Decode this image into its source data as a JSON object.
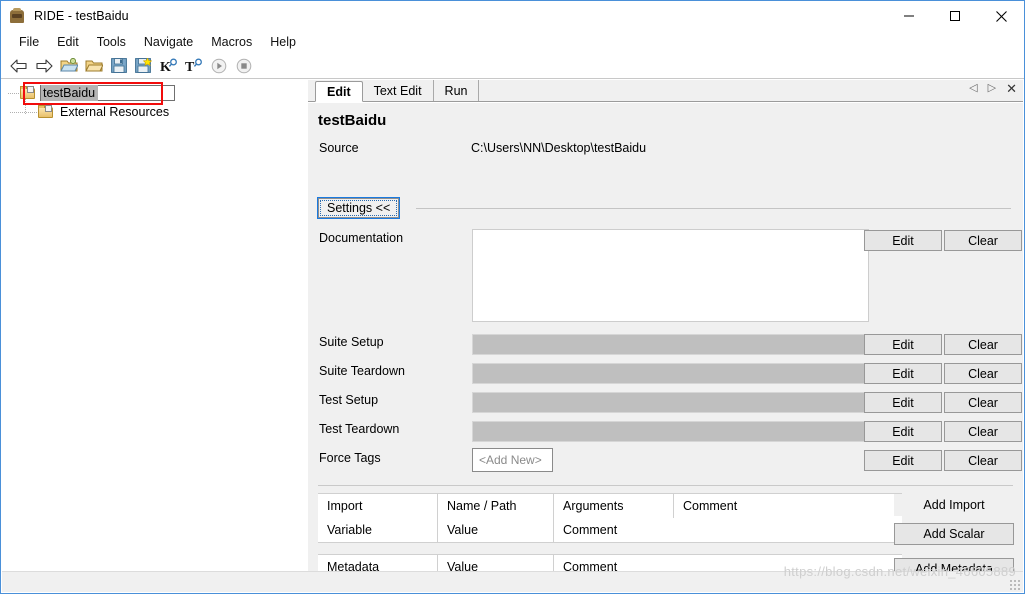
{
  "window": {
    "title": "RIDE - testBaidu",
    "app_icon": "robot-icon",
    "minimize": "—",
    "maximize": "□",
    "close": "✕"
  },
  "menubar": {
    "items": [
      {
        "label": "File"
      },
      {
        "label": "Edit"
      },
      {
        "label": "Tools"
      },
      {
        "label": "Navigate"
      },
      {
        "label": "Macros"
      },
      {
        "label": "Help"
      }
    ]
  },
  "toolbar": {
    "buttons": [
      {
        "name": "back-arrow-icon",
        "glyph": "⇦"
      },
      {
        "name": "forward-arrow-icon",
        "glyph": "⇨"
      },
      {
        "name": "open-project-icon",
        "glyph": "folder-gear"
      },
      {
        "name": "open-folder-icon",
        "glyph": "folder"
      },
      {
        "name": "save-icon",
        "glyph": "floppy"
      },
      {
        "name": "save-all-icon",
        "glyph": "floppy-star"
      },
      {
        "name": "search-keyword-icon",
        "glyph": "K"
      },
      {
        "name": "search-tests-icon",
        "glyph": "T"
      },
      {
        "name": "run-icon",
        "glyph": "▶"
      },
      {
        "name": "stop-icon",
        "glyph": "■"
      }
    ]
  },
  "tree": {
    "root": {
      "label": "testBaidu",
      "icon": "suite-folder-icon",
      "selected": true,
      "expanded": true,
      "editing": true
    },
    "children": [
      {
        "label": "External Resources",
        "icon": "resource-folder-icon"
      }
    ],
    "annotation_color": "#f10c0c"
  },
  "editor": {
    "tabs": [
      {
        "label": "Edit",
        "active": true
      },
      {
        "label": "Text Edit",
        "active": false
      },
      {
        "label": "Run",
        "active": false
      }
    ],
    "tab_tools": {
      "prev": "◁",
      "next": "▷",
      "close": "✕"
    },
    "suite_title": "testBaidu",
    "source_label": "Source",
    "source_value": "C:\\Users\\NN\\Desktop\\testBaidu",
    "settings_button": "Settings <<",
    "settings_rows": [
      {
        "label": "Documentation",
        "kind": "textarea",
        "value": "",
        "edit": "Edit",
        "clear": "Clear"
      },
      {
        "label": "Suite Setup",
        "kind": "disabled-field",
        "value": "",
        "edit": "Edit",
        "clear": "Clear"
      },
      {
        "label": "Suite Teardown",
        "kind": "disabled-field",
        "value": "",
        "edit": "Edit",
        "clear": "Clear"
      },
      {
        "label": "Test Setup",
        "kind": "disabled-field",
        "value": "",
        "edit": "Edit",
        "clear": "Clear"
      },
      {
        "label": "Test Teardown",
        "kind": "disabled-field",
        "value": "",
        "edit": "Edit",
        "clear": "Clear"
      },
      {
        "label": "Force Tags",
        "kind": "add-new",
        "value": "<Add New>",
        "edit": "Edit",
        "clear": "Clear"
      }
    ],
    "import_grid": {
      "rows": [
        {
          "cells": [
            "Import",
            "Name / Path",
            "Arguments",
            "Comment"
          ]
        },
        {
          "cells": [
            "Variable",
            "Value",
            "Comment",
            ""
          ]
        }
      ]
    },
    "metadata_grid": {
      "rows": [
        {
          "cells": [
            "Metadata",
            "Value",
            "Comment",
            ""
          ]
        }
      ]
    },
    "side_buttons": [
      {
        "label": "Add Import",
        "style": "flat"
      },
      {
        "label": "Add Scalar",
        "style": "raised"
      },
      {
        "label": "Add Metadata",
        "style": "raised"
      }
    ]
  },
  "statusbar": {
    "watermark": "https://blog.csdn.net/weixin_46605889"
  },
  "colors": {
    "accent": "#1a7ae0",
    "window_border": "#4a90d9",
    "panel_bg": "#f0f0f0",
    "selection": "#b4b4b4",
    "annotation": "#f10c0c"
  }
}
